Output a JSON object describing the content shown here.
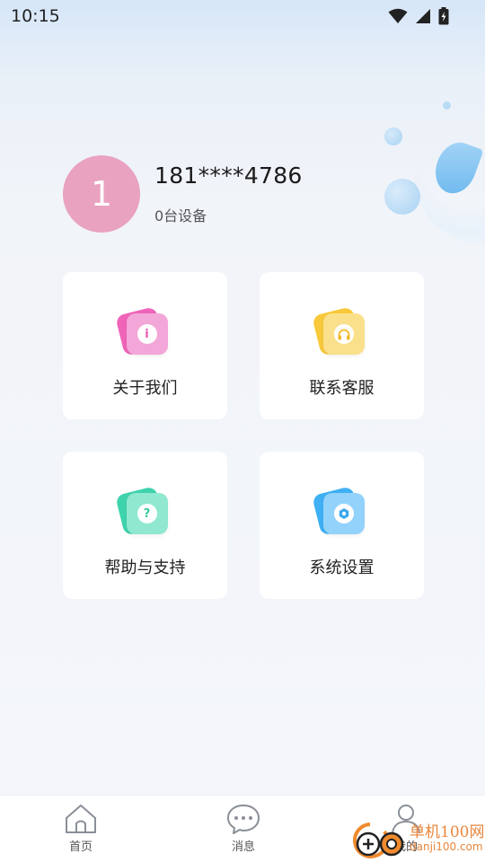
{
  "status_bar": {
    "time": "10:15"
  },
  "profile": {
    "avatar_initial": "1",
    "phone": "181****4786",
    "device_count": "0台设备"
  },
  "cards": [
    {
      "label": "关于我们",
      "icon": "info-icon",
      "front_color": "#f3a6d8",
      "back_color": "#ef64b9",
      "glyph": "i",
      "glyph_color": "#e759b3"
    },
    {
      "label": "联系客服",
      "icon": "headset-icon",
      "front_color": "#fbe08b",
      "back_color": "#f8c93a",
      "glyph": "",
      "glyph_color": "#f2b92a"
    },
    {
      "label": "帮助与支持",
      "icon": "help-icon",
      "front_color": "#8fe8cf",
      "back_color": "#3fd3ad",
      "glyph": "?",
      "glyph_color": "#36c99f"
    },
    {
      "label": "系统设置",
      "icon": "settings-icon",
      "front_color": "#93d2fb",
      "back_color": "#3fb0f3",
      "glyph": "",
      "glyph_color": "#3aa8ef"
    }
  ],
  "bottom_nav": [
    {
      "label": "首页",
      "icon": "home-icon"
    },
    {
      "label": "消息",
      "icon": "message-icon"
    },
    {
      "label": "我的",
      "icon": "user-icon"
    }
  ],
  "watermark": {
    "text": "单机100网",
    "url": "danji100.com"
  }
}
